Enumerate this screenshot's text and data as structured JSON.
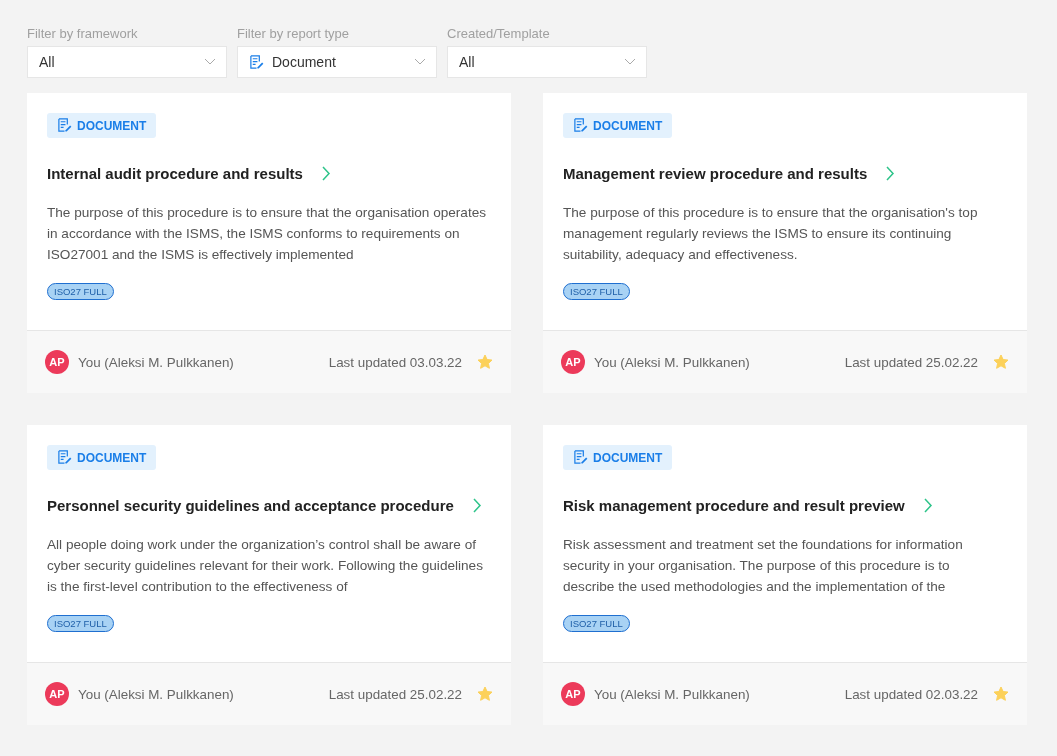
{
  "filters": [
    {
      "label": "Filter by framework",
      "value": "All",
      "icon": false
    },
    {
      "label": "Filter by report type",
      "value": "Document",
      "icon": true
    },
    {
      "label": "Created/Template",
      "value": "All",
      "icon": false
    }
  ],
  "cards": [
    {
      "type_badge": "DOCUMENT",
      "title": "Internal audit procedure and results",
      "description": "The purpose of this procedure is to ensure that the organisation operates in accordance with the ISMS, the ISMS conforms to requirements on ISO27001 and the ISMS is effectively implemented",
      "tag": "ISO27 FULL",
      "avatar": "AP",
      "author": "You (Aleksi M. Pulkkanen)",
      "updated": "Last updated 03.03.22",
      "starred": true
    },
    {
      "type_badge": "DOCUMENT",
      "title": "Management review procedure and results",
      "description": "The purpose of this procedure is to ensure that the organisation's top management regularly reviews the ISMS to ensure its continuing suitability, adequacy and effectiveness.",
      "tag": "ISO27 FULL",
      "avatar": "AP",
      "author": "You (Aleksi M. Pulkkanen)",
      "updated": "Last updated 25.02.22",
      "starred": true
    },
    {
      "type_badge": "DOCUMENT",
      "title": "Personnel security guidelines and acceptance procedure",
      "description": "All people doing work under the organization’s control shall be aware of cyber security guidelines relevant for their work. Following the guidelines is the first-level contribution to the effectiveness of",
      "tag": "ISO27 FULL",
      "avatar": "AP",
      "author": "You (Aleksi M. Pulkkanen)",
      "updated": "Last updated 25.02.22",
      "starred": true
    },
    {
      "type_badge": "DOCUMENT",
      "title": "Risk management procedure and result preview",
      "description": "Risk assessment and treatment set the foundations for information security in your organisation. The purpose of this procedure is to describe the used methodologies and the implementation of the",
      "tag": "ISO27 FULL",
      "avatar": "AP",
      "author": "You (Aleksi M. Pulkkanen)",
      "updated": "Last updated 02.03.22",
      "starred": true
    }
  ]
}
